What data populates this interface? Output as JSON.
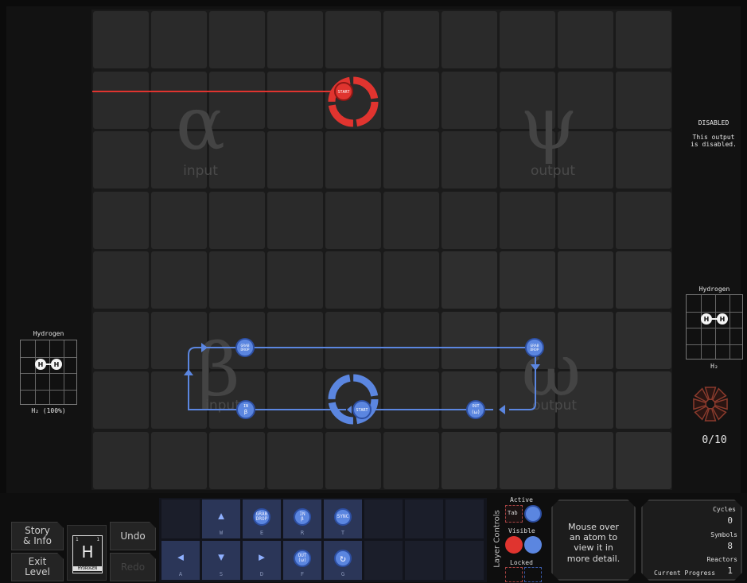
{
  "regions": {
    "alpha_letter": "α",
    "alpha_word": "input",
    "psi_letter": "ψ",
    "psi_word": "output",
    "beta_letter": "β",
    "beta_word": "input",
    "omega_letter": "ω",
    "omega_word": "output"
  },
  "left_input": {
    "title": "Hydrogen",
    "caption": "H₂ (100%)",
    "atom1": "H",
    "atom2": "H"
  },
  "right_panel": {
    "disabled_title": "DISABLED",
    "disabled_desc": "This output\nis disabled.",
    "output_title": "Hydrogen",
    "output_formula": "H₂",
    "atom1": "H",
    "atom2": "H",
    "progress": "0/10"
  },
  "reactor_labels": {
    "red_start": "START",
    "blue_start": "START",
    "grab_drop_1": "GRAB\nDROP",
    "grab_drop_2": "GRAB\nDROP",
    "in_beta": "IN\nβ",
    "out_omega": "OUT\n(ω)"
  },
  "buttons": {
    "story": "Story\n& Info",
    "undo": "Undo",
    "exit": "Exit\nLevel",
    "redo": "Redo"
  },
  "element_card": {
    "symbol": "H",
    "name": "HYDROGEN",
    "num_left": "1",
    "num_right": "1"
  },
  "tools": [
    {
      "key": "W",
      "kind": "arrow",
      "glyph": "▲"
    },
    {
      "key": "E",
      "kind": "circle",
      "label": "GRAB\nDROP"
    },
    {
      "key": "R",
      "kind": "circle",
      "label": "IN\nβ"
    },
    {
      "key": "T",
      "kind": "circle",
      "label": "SYNC"
    },
    {
      "key": "A",
      "kind": "arrow",
      "glyph": "◀"
    },
    {
      "key": "S",
      "kind": "arrow",
      "glyph": "▼"
    },
    {
      "key": "D",
      "kind": "arrow",
      "glyph": "▶"
    },
    {
      "key": "F",
      "kind": "circle",
      "label": "OUT\n(ω)"
    },
    {
      "key": "G",
      "kind": "circle",
      "label": "↻"
    }
  ],
  "layer_controls": {
    "title": "Layer Controls",
    "active": "Active",
    "tab": "Tab",
    "visible": "Visible",
    "locked": "Locked"
  },
  "mouse_over": "Mouse over\nan atom to\nview it in\nmore detail.",
  "stats": {
    "cycles_label": "Cycles",
    "cycles_value": "0",
    "symbols_label": "Symbols",
    "symbols_value": "8",
    "reactors_label": "Reactors",
    "reactors_value": "1",
    "current_progress": "Current Progress"
  },
  "colors": {
    "red": "#e0342f",
    "blue": "#5b86e0",
    "blue_dark": "#2d4fa3"
  }
}
